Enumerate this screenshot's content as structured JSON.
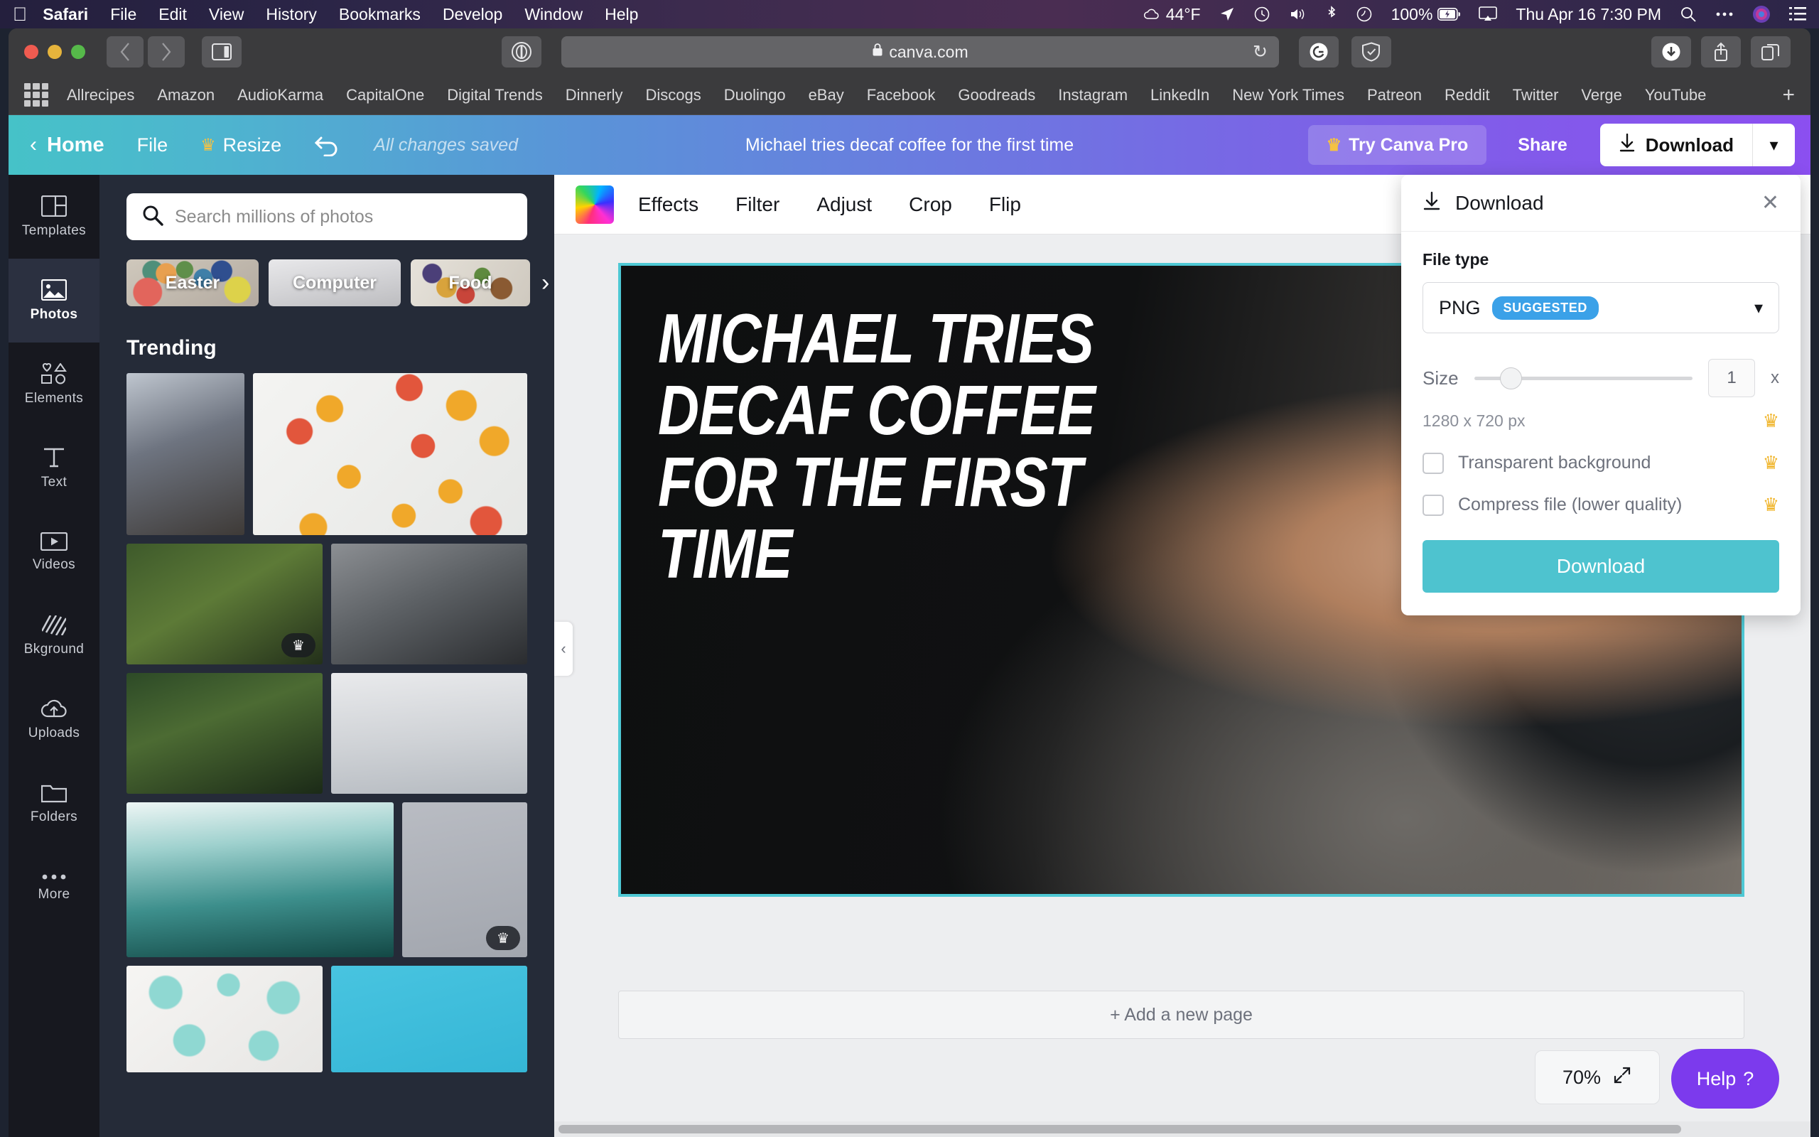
{
  "menubar": {
    "apple_icon": "apple-icon",
    "items": [
      "Safari",
      "File",
      "Edit",
      "View",
      "History",
      "Bookmarks",
      "Develop",
      "Window",
      "Help"
    ],
    "status": {
      "weather_icon": "cloud-icon",
      "weather": "44°F",
      "location_icon": "location-arrow-icon",
      "timemachine_icon": "time-machine-icon",
      "volume_icon": "speaker-icon",
      "bluetooth_icon": "bluetooth-icon",
      "dropbox_icon": "dropbox-icon",
      "battery_pct": "100%",
      "battery_icon": "battery-charging-icon",
      "airplay_icon": "airplay-icon",
      "datetime": "Thu Apr 16  7:30 PM",
      "search_icon": "search-icon",
      "controlcenter_icon": "ellipsis-icon",
      "siri_icon": "siri-icon",
      "notification_icon": "list-icon"
    }
  },
  "safari": {
    "traffic": [
      "close-button",
      "minimize-button",
      "zoom-button"
    ],
    "back_icon": "chevron-left-icon",
    "forward_icon": "chevron-right-icon",
    "sidebar_icon": "sidebar-icon",
    "reader_icon": "reader-icon",
    "url": "canva.com",
    "lock_icon": "lock-icon",
    "reload_icon": "reload-icon",
    "grammarly_icon": "grammarly-icon",
    "shield_icon": "shield-icon",
    "downloads_icon": "downloads-icon",
    "share_icon": "share-icon",
    "tabs_icon": "tab-overview-icon",
    "bookmarks": [
      "Allrecipes",
      "Amazon",
      "AudioKarma",
      "CapitalOne",
      "Digital Trends",
      "Dinnerly",
      "Discogs",
      "Duolingo",
      "eBay",
      "Facebook",
      "Goodreads",
      "Instagram",
      "LinkedIn",
      "New York Times",
      "Patreon",
      "Reddit",
      "Twitter",
      "Verge",
      "YouTube"
    ],
    "bookmarks_add_icon": "plus-icon"
  },
  "canva": {
    "topbar": {
      "back_icon": "chevron-left-icon",
      "home": "Home",
      "file": "File",
      "resize": "Resize",
      "resize_crown_icon": "crown-icon",
      "undo_icon": "undo-icon",
      "saved_status": "All changes saved",
      "doc_title": "Michael tries decaf coffee for the first time",
      "try_pro": "Try Canva Pro",
      "try_pro_crown_icon": "crown-icon",
      "share": "Share",
      "download": "Download",
      "download_icon": "download-arrow-icon",
      "download_caret_icon": "chevron-down-icon"
    },
    "rail": [
      {
        "label": "Templates",
        "icon": "templates-icon",
        "active": false
      },
      {
        "label": "Photos",
        "icon": "photos-icon",
        "active": true
      },
      {
        "label": "Elements",
        "icon": "elements-icon",
        "active": false
      },
      {
        "label": "Text",
        "icon": "text-icon",
        "active": false
      },
      {
        "label": "Videos",
        "icon": "videos-icon",
        "active": false
      },
      {
        "label": "Bkground",
        "icon": "background-icon",
        "active": false
      },
      {
        "label": "Uploads",
        "icon": "uploads-icon",
        "active": false
      },
      {
        "label": "Folders",
        "icon": "folders-icon",
        "active": false
      },
      {
        "label": "More",
        "icon": "more-icon",
        "active": false
      }
    ],
    "photos_panel": {
      "search_icon": "search-icon",
      "search_placeholder": "Search millions of photos",
      "search_value": "",
      "categories": [
        "Easter",
        "Computer",
        "Food"
      ],
      "categories_next_icon": "chevron-right-icon",
      "trending_heading": "Trending",
      "pro_badge_icon": "crown-icon"
    },
    "image_toolbar": {
      "swatch_icon": "color-swatch-icon",
      "items": [
        "Effects",
        "Filter",
        "Adjust",
        "Crop",
        "Flip"
      ]
    },
    "canvas": {
      "headline_lines": [
        "MICHAEL TRIES",
        "DECAF COFFEE",
        "FOR THE FIRST",
        "TIME"
      ],
      "collapse_icon": "chevron-left-icon",
      "add_page": "+ Add a new page",
      "zoom_level": "70%",
      "fit_icon": "expand-icon",
      "help": "Help",
      "help_icon": "question-mark-icon"
    },
    "download_panel": {
      "title": "Download",
      "title_icon": "download-arrow-icon",
      "close_icon": "close-icon",
      "file_type_label": "File type",
      "file_type_value": "PNG",
      "file_type_badge": "SUGGESTED",
      "file_type_caret_icon": "chevron-down-icon",
      "size_label": "Size",
      "size_multiplier": "1",
      "size_unit": "x",
      "dimensions": "1280 x 720 px",
      "dimensions_crown_icon": "crown-icon",
      "transparent_label": "Transparent background",
      "transparent_crown_icon": "crown-icon",
      "compress_label": "Compress file (lower quality)",
      "compress_crown_icon": "crown-icon",
      "download_button": "Download"
    }
  },
  "colors": {
    "accent_teal": "#4ec3cf",
    "purple": "#7c3aed",
    "suggested_blue": "#3ba1e8",
    "crown_gold": "#f0b429",
    "rail_bg": "#17181f",
    "panel_bg": "#252b38"
  }
}
